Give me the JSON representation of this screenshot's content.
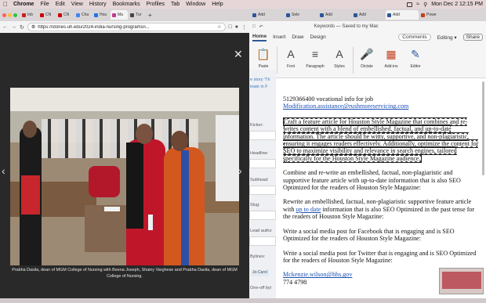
{
  "menubar": {
    "app": "Chrome",
    "items": [
      "File",
      "Edit",
      "View",
      "History",
      "Bookmarks",
      "Profiles",
      "Tab",
      "Window",
      "Help"
    ],
    "clock": "Mon Dec 2  12:15 PM"
  },
  "chrome": {
    "tabs": [
      {
        "label": "Inb",
        "color": "#c5221f"
      },
      {
        "label": "CN",
        "color": "#cc0000"
      },
      {
        "label": "CN",
        "color": "#cc0000"
      },
      {
        "label": "Cha",
        "color": "#4285f4"
      },
      {
        "label": "Hou",
        "color": "#1a73e8"
      },
      {
        "label": "Ma",
        "color": "#c23b8a"
      },
      {
        "label": "Tur",
        "color": "#444444"
      }
    ],
    "url": "https://stories.uh.edu/2024-india-nursing-programs/i..."
  },
  "lightbox": {
    "caption": "Prabha Dasila, dean of MGM College of Nursing with Beena Joseph, Shainy Varghese and Prabha Dasila, dean of MGM College of Nursing."
  },
  "word": {
    "tabs": [
      {
        "label": "Add",
        "color": "#2b579a"
      },
      {
        "label": "Sele",
        "color": "#2b579a"
      },
      {
        "label": "Add",
        "color": "#2b579a"
      },
      {
        "label": "Add",
        "color": "#2b579a"
      },
      {
        "label": "Add",
        "color": "#2b579a"
      },
      {
        "label": "Powe",
        "color": "#c43e1c"
      }
    ],
    "doc_title": "Keywords — Saved to my Mac",
    "ribbon_tabs": [
      "Home",
      "Insert",
      "Draw",
      "Design"
    ],
    "comments_label": "Comments",
    "editing_label": "Editing",
    "share_label": "Share",
    "ribbon_groups": [
      {
        "label": "Paste",
        "icon": "clipboard-icon"
      },
      {
        "label": "Font",
        "icon": "font-icon"
      },
      {
        "label": "Paragraph",
        "icon": "paragraph-icon"
      },
      {
        "label": "Styles",
        "icon": "styles-icon"
      },
      {
        "label": "Dictate",
        "icon": "microphone-icon"
      },
      {
        "label": "Add-ins",
        "icon": "add-ins-icon"
      },
      {
        "label": "Editor",
        "icon": "editor-icon"
      }
    ]
  },
  "document": {
    "line1": "5129366400 vocational info for job",
    "email1": "Modification.assistance@rushmoreservicing.com",
    "para_boxed": "Craft a feature article for Houston Style Magazine that combines and re-writes content with a blend of embellished, factual, and up-to-date information. The article should be witty, supportive, and non-plagiaristic, ensuring it engages readers effectively. Additionally, optimize the content for SEO to maximize visibility and relevance in search engines, tailored specifically for the Houston Style Magazine audience.",
    "para2": "Combine and re-write an embellished, factual, non-plagiaristic and supportive feature article with up-to-date information that is also SEO Optimized for the readers of Houston Style Magazine:",
    "para3_a": "Rewrite an embellished, factual, non-plagiaristic supportive feature article with ",
    "para3_link": "up to date",
    "para3_b": " information that is also SEO Optimized in the past tense  for the readers of Houston Style Magazine:",
    "para4": "Write a social media post for Facebook that is engaging and is SEO Optimized for the readers of Houston Style Magazine:",
    "para5": "Write a social media post for Twitter that is engaging and is SEO Optimized for the readers of Houston Style Magazine:",
    "email2": "Mckenzie.wilson@hhs.gov",
    "phone": "774 4798"
  },
  "behind_window": {
    "story_text": "e story 'Th",
    "nate_text": "inate in F",
    "labels": [
      "Kicker:",
      "Headline:",
      "Subhead:",
      "Slug:",
      "Lead autho",
      "Bylines:",
      "One-off byl"
    ],
    "chip": "Jo-Carol"
  }
}
